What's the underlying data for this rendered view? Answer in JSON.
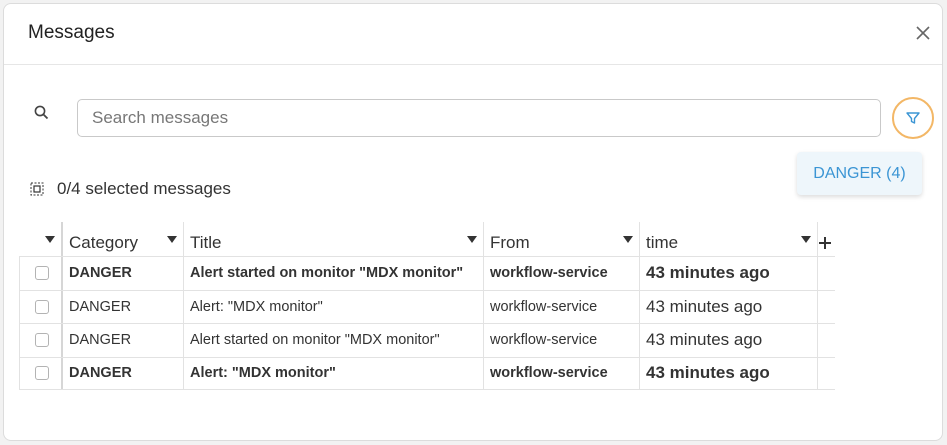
{
  "dialog": {
    "title": "Messages"
  },
  "search": {
    "placeholder": "Search messages",
    "value": ""
  },
  "filters": {
    "active_chip": "DANGER (4)"
  },
  "selection": {
    "label": "0/4 selected messages"
  },
  "grid": {
    "columns": [
      "Category",
      "Title",
      "From",
      "time"
    ],
    "rows": [
      {
        "category": "DANGER",
        "title": "Alert started on monitor \"MDX monitor\"",
        "from": "workflow-service",
        "time": "43 minutes ago",
        "bold": true
      },
      {
        "category": "DANGER",
        "title": "Alert: \"MDX monitor\"",
        "from": "workflow-service",
        "time": "43 minutes ago",
        "bold": false
      },
      {
        "category": "DANGER",
        "title": "Alert started on monitor \"MDX monitor\"",
        "from": "workflow-service",
        "time": "43 minutes ago",
        "bold": false
      },
      {
        "category": "DANGER",
        "title": "Alert: \"MDX monitor\"",
        "from": "workflow-service",
        "time": "43 minutes ago",
        "bold": true
      }
    ]
  },
  "icons": {
    "close": "close-icon",
    "search": "search-icon",
    "filter": "filter-icon",
    "select_all": "select-all-icon",
    "add_column": "plus-icon"
  },
  "colors": {
    "accent": "#3b95d4",
    "filter_ring": "#f3b766",
    "chip_bg": "#eef6fb"
  }
}
